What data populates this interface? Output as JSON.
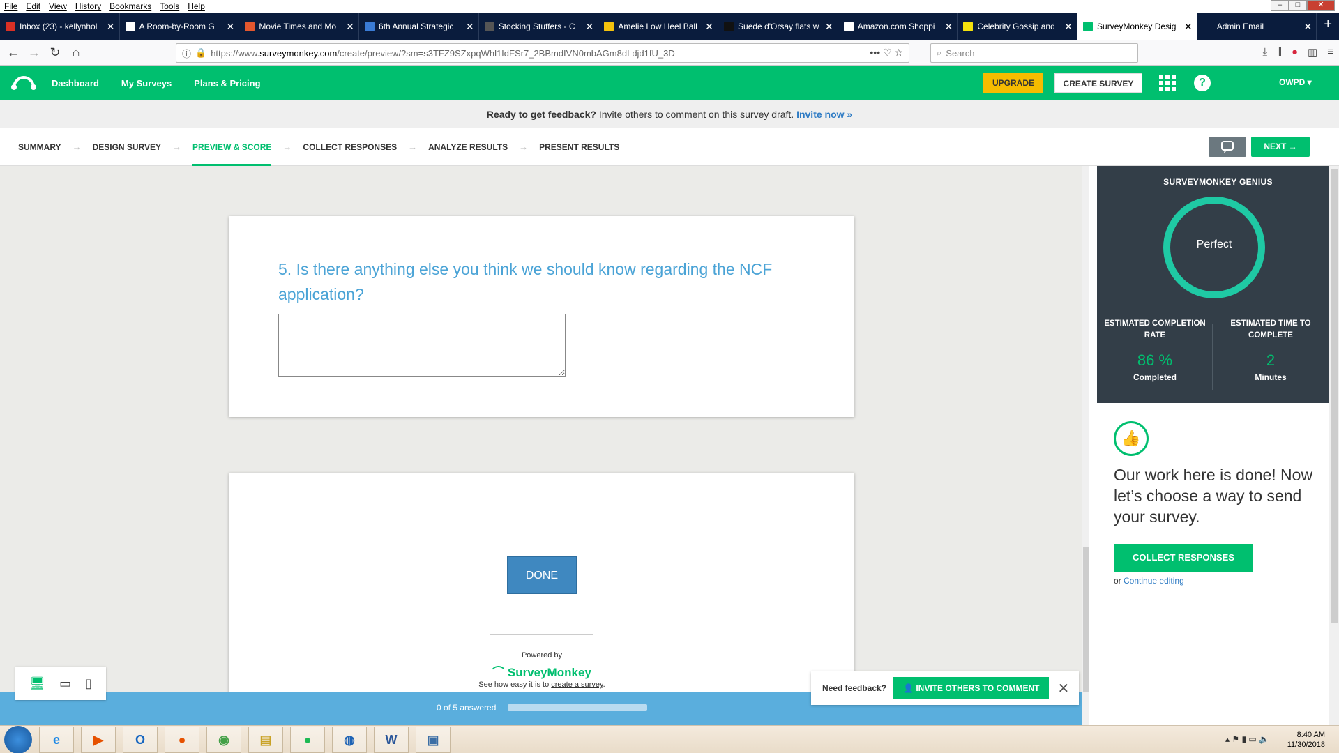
{
  "menu": [
    "File",
    "Edit",
    "View",
    "History",
    "Bookmarks",
    "Tools",
    "Help"
  ],
  "window_controls": [
    "–",
    "□",
    "✕"
  ],
  "tabs": [
    {
      "title": "Inbox (23) - kellynhol",
      "color": "#d93025"
    },
    {
      "title": "A Room-by-Room G",
      "color": "#ffffff"
    },
    {
      "title": "Movie Times and Mo",
      "color": "#e4572e"
    },
    {
      "title": "6th Annual Strategic",
      "color": "#3a7bd5"
    },
    {
      "title": "Stocking Stuffers - C",
      "color": "#555555"
    },
    {
      "title": "Amelie Low Heel Ball",
      "color": "#f4c20d"
    },
    {
      "title": "Suede d'Orsay flats w",
      "color": "#111111"
    },
    {
      "title": "Amazon.com Shoppi",
      "color": "#ffffff"
    },
    {
      "title": "Celebrity Gossip and",
      "color": "#f4e10d"
    },
    {
      "title": "SurveyMonkey Desig",
      "color": "#00bf6f"
    },
    {
      "title": "Admin Email",
      "color": "#0a1c3d"
    }
  ],
  "active_tab_index": 9,
  "url": {
    "prefix": "https://www.",
    "host": "surveymonkey.com",
    "path": "/create/preview/?sm=s3TFZ9SZxpqWhl1IdFSr7_2BBmdIVN0mbAGm8dLdjd1fU_3D"
  },
  "search_placeholder": "Search",
  "header": {
    "nav": [
      "Dashboard",
      "My Surveys",
      "Plans & Pricing"
    ],
    "upgrade": "UPGRADE",
    "create": "CREATE SURVEY",
    "help": "?",
    "user": "OWPD ▾"
  },
  "banner": {
    "bold": "Ready to get feedback?",
    "text": " Invite others to comment on this survey draft. ",
    "link": "Invite now »"
  },
  "steps": [
    "SUMMARY",
    "DESIGN SURVEY",
    "PREVIEW & SCORE",
    "COLLECT RESPONSES",
    "ANALYZE RESULTS",
    "PRESENT RESULTS"
  ],
  "active_step": 2,
  "next_label": "NEXT →",
  "question": {
    "text": "5. Is there anything else you think we should know regarding the NCF application?",
    "answer": ""
  },
  "done_label": "DONE",
  "powered": {
    "by": "Powered by",
    "brand": "SurveyMonkey",
    "see_prefix": "See how easy it is to ",
    "see_link": "create a survey",
    "see_suffix": "."
  },
  "progress": {
    "text": "0 of 5 answered",
    "answered": 0,
    "total": 5
  },
  "feedback": {
    "label": "Need feedback?",
    "button": "INVITE OTHERS TO COMMENT"
  },
  "genius": {
    "title": "SURVEYMONKEY GENIUS",
    "rating": "Perfect",
    "completion": {
      "heading": "ESTIMATED COMPLETION RATE",
      "value": "86 %",
      "unit": "Completed"
    },
    "time": {
      "heading": "ESTIMATED TIME TO COMPLETE",
      "value": "2",
      "unit": "Minutes"
    }
  },
  "done_panel": {
    "heading": "Our work here is done! Now let’s choose a way to send your survey.",
    "button": "COLLECT RESPONSES",
    "or": "or ",
    "link": "Continue editing"
  },
  "taskbar": {
    "time": "8:40 AM",
    "date": "11/30/2018"
  },
  "colors": {
    "brand": "#00bf6f",
    "accent_blue": "#4aa3d6",
    "upgrade": "#f6bc00",
    "genius_bg": "#333e48"
  }
}
